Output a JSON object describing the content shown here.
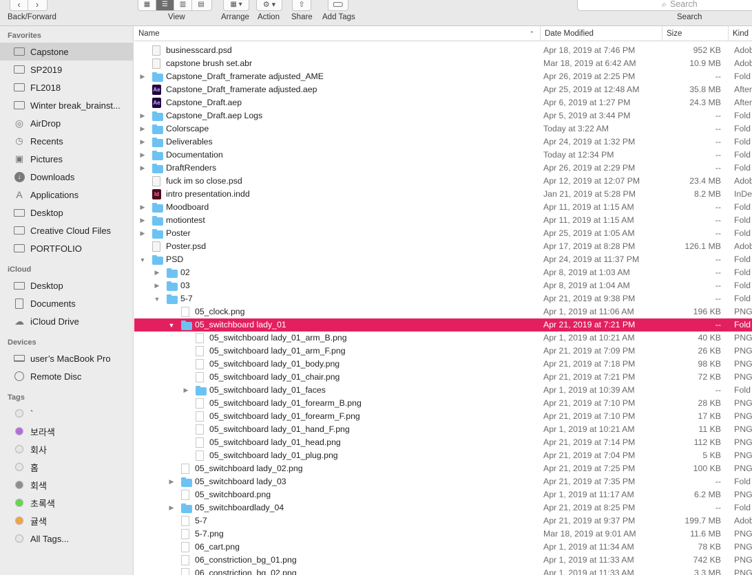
{
  "toolbar": {
    "back_forward_label": "Back/Forward",
    "view_label": "View",
    "arrange_label": "Arrange",
    "action_label": "Action",
    "share_label": "Share",
    "add_tags_label": "Add Tags",
    "search_label": "Search",
    "search_placeholder": "Search"
  },
  "sidebar": {
    "favorites_header": "Favorites",
    "favorites": [
      {
        "label": "Capstone",
        "icon": "folder-icon",
        "selected": true
      },
      {
        "label": "SP2019",
        "icon": "folder-icon"
      },
      {
        "label": "FL2018",
        "icon": "folder-icon"
      },
      {
        "label": "Winter break_brainst...",
        "icon": "folder-icon"
      },
      {
        "label": "AirDrop",
        "icon": "airdrop-icon"
      },
      {
        "label": "Recents",
        "icon": "clock-icon"
      },
      {
        "label": "Pictures",
        "icon": "camera-icon"
      },
      {
        "label": "Downloads",
        "icon": "download-icon"
      },
      {
        "label": "Applications",
        "icon": "applications-icon"
      },
      {
        "label": "Desktop",
        "icon": "desktop-icon"
      },
      {
        "label": "Creative Cloud Files",
        "icon": "creative-cloud-icon"
      },
      {
        "label": "PORTFOLIO",
        "icon": "folder-icon"
      }
    ],
    "icloud_header": "iCloud",
    "icloud": [
      {
        "label": "Desktop",
        "icon": "desktop-icon"
      },
      {
        "label": "Documents",
        "icon": "document-icon"
      },
      {
        "label": "iCloud Drive",
        "icon": "cloud-icon"
      }
    ],
    "devices_header": "Devices",
    "devices": [
      {
        "label": "user’s MacBook Pro",
        "icon": "laptop-icon"
      },
      {
        "label": "Remote Disc",
        "icon": "disc-icon"
      }
    ],
    "tags_header": "Tags",
    "tags": [
      {
        "label": "`",
        "color": "#e6e6e6"
      },
      {
        "label": "보라색",
        "color": "#b46be0"
      },
      {
        "label": "회사",
        "color": "#e6e6e6"
      },
      {
        "label": "홈",
        "color": "#e6e6e6"
      },
      {
        "label": "회색",
        "color": "#8e8e8e"
      },
      {
        "label": "초록색",
        "color": "#62d84c"
      },
      {
        "label": "귤색",
        "color": "#f5a33c"
      },
      {
        "label": "All Tags...",
        "color": "#e6e6e6"
      }
    ]
  },
  "columns": {
    "name": "Name",
    "date": "Date Modified",
    "size": "Size",
    "kind": "Kind"
  },
  "files": [
    {
      "name": "businesscard.psd",
      "date": "Apr 18, 2019 at 7:46 PM",
      "size": "952 KB",
      "kind": "Adob",
      "level": 0,
      "icon": "doc",
      "disclosure": ""
    },
    {
      "name": "capstone brush set.abr",
      "date": "Mar 18, 2019 at 6:42 AM",
      "size": "10.9 MB",
      "kind": "Adob",
      "level": 0,
      "icon": "doc",
      "disclosure": ""
    },
    {
      "name": "Capstone_Draft_framerate adjusted_AME",
      "date": "Apr 26, 2019 at 2:25 PM",
      "size": "--",
      "kind": "Fold",
      "level": 0,
      "icon": "folder",
      "disclosure": "closed"
    },
    {
      "name": "Capstone_Draft_framerate adjusted.aep",
      "date": "Apr 25, 2019 at 12:48 AM",
      "size": "35.8 MB",
      "kind": "After",
      "level": 0,
      "icon": "ae",
      "disclosure": ""
    },
    {
      "name": "Capstone_Draft.aep",
      "date": "Apr 6, 2019 at 1:27 PM",
      "size": "24.3 MB",
      "kind": "After",
      "level": 0,
      "icon": "ae",
      "disclosure": ""
    },
    {
      "name": "Capstone_Draft.aep Logs",
      "date": "Apr 5, 2019 at 3:44 PM",
      "size": "--",
      "kind": "Fold",
      "level": 0,
      "icon": "folder",
      "disclosure": "closed"
    },
    {
      "name": "Colorscape",
      "date": "Today at 3:22 AM",
      "size": "--",
      "kind": "Fold",
      "level": 0,
      "icon": "folder",
      "disclosure": "closed"
    },
    {
      "name": "Deliverables",
      "date": "Apr 24, 2019 at 1:32 PM",
      "size": "--",
      "kind": "Fold",
      "level": 0,
      "icon": "folder",
      "disclosure": "closed"
    },
    {
      "name": "Documentation",
      "date": "Today at 12:34 PM",
      "size": "--",
      "kind": "Fold",
      "level": 0,
      "icon": "folder",
      "disclosure": "closed"
    },
    {
      "name": "DraftRenders",
      "date": "Apr 26, 2019 at 2:29 PM",
      "size": "--",
      "kind": "Fold",
      "level": 0,
      "icon": "folder",
      "disclosure": "closed"
    },
    {
      "name": "fuck im so close.psd",
      "date": "Apr 12, 2019 at 12:07 PM",
      "size": "23.4 MB",
      "kind": "Adob",
      "level": 0,
      "icon": "doc",
      "disclosure": ""
    },
    {
      "name": "intro presentation.indd",
      "date": "Jan 21, 2019 at 5:28 PM",
      "size": "8.2 MB",
      "kind": "InDe",
      "level": 0,
      "icon": "indd",
      "disclosure": ""
    },
    {
      "name": "Moodboard",
      "date": "Apr 11, 2019 at 1:15 AM",
      "size": "--",
      "kind": "Fold",
      "level": 0,
      "icon": "folder",
      "disclosure": "closed"
    },
    {
      "name": "motiontest",
      "date": "Apr 11, 2019 at 1:15 AM",
      "size": "--",
      "kind": "Fold",
      "level": 0,
      "icon": "folder",
      "disclosure": "closed"
    },
    {
      "name": "Poster",
      "date": "Apr 25, 2019 at 1:05 AM",
      "size": "--",
      "kind": "Fold",
      "level": 0,
      "icon": "folder",
      "disclosure": "closed"
    },
    {
      "name": "Poster.psd",
      "date": "Apr 17, 2019 at 8:28 PM",
      "size": "126.1 MB",
      "kind": "Adob",
      "level": 0,
      "icon": "doc",
      "disclosure": ""
    },
    {
      "name": "PSD",
      "date": "Apr 24, 2019 at 11:37 PM",
      "size": "--",
      "kind": "Fold",
      "level": 0,
      "icon": "folder",
      "disclosure": "open"
    },
    {
      "name": "02",
      "date": "Apr 8, 2019 at 1:03 AM",
      "size": "--",
      "kind": "Fold",
      "level": 1,
      "icon": "folder",
      "disclosure": "closed"
    },
    {
      "name": "03",
      "date": "Apr 8, 2019 at 1:04 AM",
      "size": "--",
      "kind": "Fold",
      "level": 1,
      "icon": "folder",
      "disclosure": "closed"
    },
    {
      "name": "5-7",
      "date": "Apr 21, 2019 at 9:38 PM",
      "size": "--",
      "kind": "Fold",
      "level": 1,
      "icon": "folder",
      "disclosure": "open"
    },
    {
      "name": "05_clock.png",
      "date": "Apr 1, 2019 at 11:06 AM",
      "size": "196 KB",
      "kind": "PNG",
      "level": 2,
      "icon": "png",
      "disclosure": ""
    },
    {
      "name": "05_switchboard lady_01",
      "date": "Apr 21, 2019 at 7:21 PM",
      "size": "--",
      "kind": "Fold",
      "level": 2,
      "icon": "folder",
      "disclosure": "open",
      "selected": true
    },
    {
      "name": "05_switchboard lady_01_arm_B.png",
      "date": "Apr 1, 2019 at 10:21 AM",
      "size": "40 KB",
      "kind": "PNG",
      "level": 3,
      "icon": "png",
      "disclosure": ""
    },
    {
      "name": "05_switchboard lady_01_arm_F.png",
      "date": "Apr 21, 2019 at 7:09 PM",
      "size": "26 KB",
      "kind": "PNG",
      "level": 3,
      "icon": "png",
      "disclosure": ""
    },
    {
      "name": "05_switchboard lady_01_body.png",
      "date": "Apr 21, 2019 at 7:18 PM",
      "size": "98 KB",
      "kind": "PNG",
      "level": 3,
      "icon": "png",
      "disclosure": ""
    },
    {
      "name": "05_switchboard lady_01_chair.png",
      "date": "Apr 21, 2019 at 7:21 PM",
      "size": "72 KB",
      "kind": "PNG",
      "level": 3,
      "icon": "png",
      "disclosure": ""
    },
    {
      "name": "05_switchboard lady_01_faces",
      "date": "Apr 1, 2019 at 10:39 AM",
      "size": "--",
      "kind": "Fold",
      "level": 3,
      "icon": "folder",
      "disclosure": "closed"
    },
    {
      "name": "05_switchboard lady_01_forearm_B.png",
      "date": "Apr 21, 2019 at 7:10 PM",
      "size": "28 KB",
      "kind": "PNG",
      "level": 3,
      "icon": "png",
      "disclosure": ""
    },
    {
      "name": "05_switchboard lady_01_forearm_F.png",
      "date": "Apr 21, 2019 at 7:10 PM",
      "size": "17 KB",
      "kind": "PNG",
      "level": 3,
      "icon": "png",
      "disclosure": ""
    },
    {
      "name": "05_switchboard lady_01_hand_F.png",
      "date": "Apr 1, 2019 at 10:21 AM",
      "size": "11 KB",
      "kind": "PNG",
      "level": 3,
      "icon": "png",
      "disclosure": ""
    },
    {
      "name": "05_switchboard lady_01_head.png",
      "date": "Apr 21, 2019 at 7:14 PM",
      "size": "112 KB",
      "kind": "PNG",
      "level": 3,
      "icon": "png",
      "disclosure": ""
    },
    {
      "name": "05_switchboard lady_01_plug.png",
      "date": "Apr 21, 2019 at 7:04 PM",
      "size": "5 KB",
      "kind": "PNG",
      "level": 3,
      "icon": "png",
      "disclosure": ""
    },
    {
      "name": "05_switchboard lady_02.png",
      "date": "Apr 21, 2019 at 7:25 PM",
      "size": "100 KB",
      "kind": "PNG",
      "level": 2,
      "icon": "png",
      "disclosure": ""
    },
    {
      "name": "05_switchboard lady_03",
      "date": "Apr 21, 2019 at 7:35 PM",
      "size": "--",
      "kind": "Fold",
      "level": 2,
      "icon": "folder",
      "disclosure": "closed"
    },
    {
      "name": "05_switchboard.png",
      "date": "Apr 1, 2019 at 11:17 AM",
      "size": "6.2 MB",
      "kind": "PNG",
      "level": 2,
      "icon": "png",
      "disclosure": ""
    },
    {
      "name": "05_switchboardlady_04",
      "date": "Apr 21, 2019 at 8:25 PM",
      "size": "--",
      "kind": "Fold",
      "level": 2,
      "icon": "folder",
      "disclosure": "closed"
    },
    {
      "name": "5-7",
      "date": "Apr 21, 2019 at 9:37 PM",
      "size": "199.7 MB",
      "kind": "Adob",
      "level": 2,
      "icon": "png",
      "disclosure": ""
    },
    {
      "name": "5-7.png",
      "date": "Mar 18, 2019 at 9:01 AM",
      "size": "11.6 MB",
      "kind": "PNG",
      "level": 2,
      "icon": "png",
      "disclosure": ""
    },
    {
      "name": "06_cart.png",
      "date": "Apr 1, 2019 at 11:34 AM",
      "size": "78 KB",
      "kind": "PNG",
      "level": 2,
      "icon": "png",
      "disclosure": ""
    },
    {
      "name": "06_constriction_bg_01.png",
      "date": "Apr 1, 2019 at 11:33 AM",
      "size": "742 KB",
      "kind": "PNG",
      "level": 2,
      "icon": "png",
      "disclosure": ""
    },
    {
      "name": "06_constriction_bg_02.png",
      "date": "Apr 1, 2019 at 11:33 AM",
      "size": "3.3 MB",
      "kind": "PNG",
      "level": 2,
      "icon": "png",
      "disclosure": ""
    }
  ],
  "colors": {
    "selection": "#e3205f",
    "folder": "#6cc3f3"
  }
}
